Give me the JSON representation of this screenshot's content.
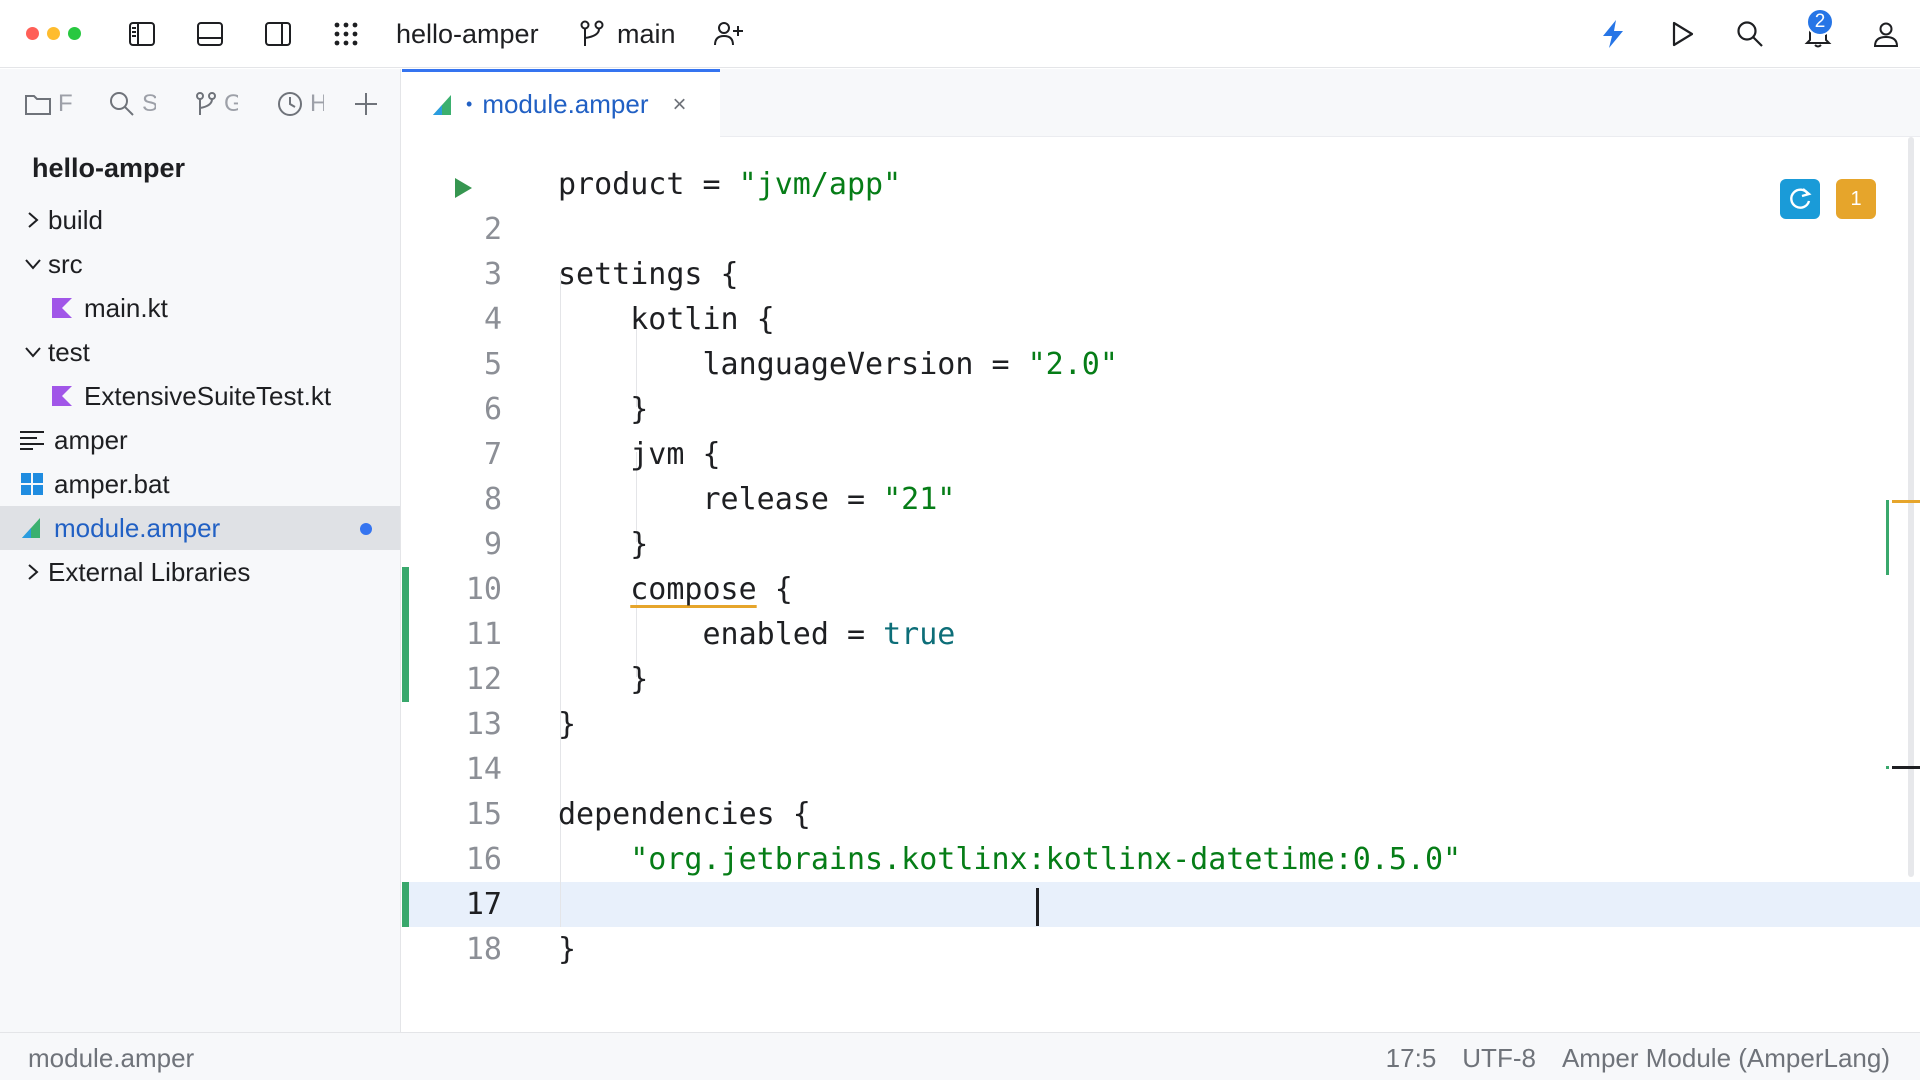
{
  "window": {
    "project_name": "hello-amper",
    "branch": "main",
    "notifications_count": "2"
  },
  "left_tabs": [
    {
      "name": "Project",
      "visible": "F"
    },
    {
      "name": "Search",
      "visible": "S"
    },
    {
      "name": "Git",
      "visible": "G"
    },
    {
      "name": "History",
      "visible": "H"
    }
  ],
  "tree": {
    "root": "hello-amper",
    "items": [
      {
        "label": "build",
        "expand": "collapsed",
        "icon": "chevron-right-icon"
      },
      {
        "label": "src",
        "expand": "expanded",
        "icon": "chevron-down-icon"
      },
      {
        "label": "main.kt",
        "icon": "kotlin-file-icon"
      },
      {
        "label": "test",
        "expand": "expanded",
        "icon": "chevron-down-icon"
      },
      {
        "label": "ExtensiveSuiteTest.kt",
        "icon": "kotlin-file-icon"
      },
      {
        "label": "amper",
        "icon": "text-file-icon"
      },
      {
        "label": "amper.bat",
        "icon": "windows-file-icon"
      },
      {
        "label": "module.amper",
        "icon": "amper-file-icon",
        "selected": true
      },
      {
        "label": "External Libraries",
        "expand": "collapsed",
        "icon": "chevron-right-icon"
      }
    ]
  },
  "editor_tab": {
    "file_name": "module.amper",
    "modified_marker": "•",
    "close_glyph": "×"
  },
  "editor": {
    "line_numbers": [
      "",
      "2",
      "3",
      "4",
      "5",
      "6",
      "7",
      "8",
      "9",
      "10",
      "11",
      "12",
      "13",
      "14",
      "15",
      "16",
      "17",
      "18"
    ],
    "current_line": "17",
    "warnings_count": "1",
    "code": {
      "l1_key": "product",
      "l1_op": " = ",
      "l1_val": "\"jvm/app\"",
      "l3": "settings {",
      "l4": "    kotlin {",
      "l5_key": "        languageVersion",
      "l5_op": " = ",
      "l5_val": "\"2.0\"",
      "l6": "    }",
      "l7": "    jvm {",
      "l8_key": "        release",
      "l8_op": " = ",
      "l8_val": "\"21\"",
      "l9": "    }",
      "l10_indent": "    ",
      "l10_key": "compose",
      "l10_rest": " {",
      "l11_key": "        enabled",
      "l11_op": " = ",
      "l11_val": "true",
      "l12": "    }",
      "l13": "}",
      "l15": "dependencies {",
      "l16_indent": "    ",
      "l16_val": "\"org.jetbrains.kotlinx:kotlinx-datetime:0.5.0\"",
      "l18": "}"
    }
  },
  "statusbar": {
    "file": "module.amper",
    "position": "17:5",
    "encoding": "UTF-8",
    "language": "Amper Module (AmperLang)"
  },
  "colors": {
    "accent": "#3574f0",
    "string": "#067d17",
    "keyword": "#0d6e78",
    "change_bar": "#39a86c",
    "warning": "#e6a52b",
    "reload_button": "#1a9bd8"
  }
}
